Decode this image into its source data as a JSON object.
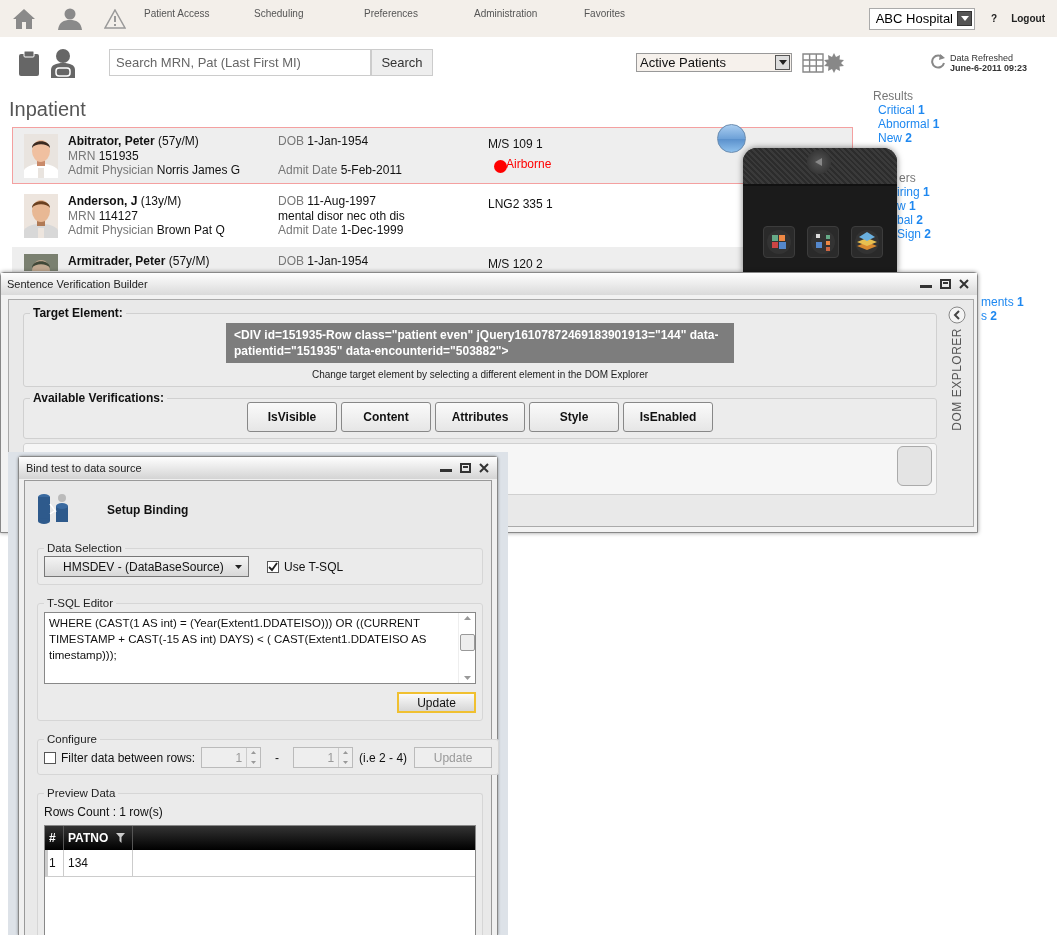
{
  "top_nav": {
    "nav_items": [
      "Patient Access",
      "Scheduling",
      "Preferences",
      "Administration",
      "Favorites"
    ],
    "hospital": "ABC Hospital",
    "help": "?",
    "logout": "Logout"
  },
  "toolbar": {
    "search_placeholder": "Search MRN, Pat (Last First MI)",
    "search_button": "Search",
    "filter": "Active Patients",
    "refresh_label": "Data Refreshed",
    "refresh_time": "June-6-2011 09:23"
  },
  "inpatient": {
    "title": "Inpatient",
    "patients": [
      {
        "name": "Abitrator, Peter",
        "age": "(57y/M)",
        "mrn_label": "MRN",
        "mrn": "151935",
        "physician_label": "Admit Physician",
        "physician": "Norris James G",
        "dob_label": "DOB",
        "dob": "1-Jan-1954",
        "admit_label": "Admit Date",
        "admit_date": "5-Feb-2011",
        "location": "M/S 109 1",
        "alert": {
          "text": "Airborne",
          "color": "#ff0000"
        },
        "selected": true
      },
      {
        "name": "Anderson, J",
        "age": "(13y/M)",
        "mrn_label": "MRN",
        "mrn": "114127",
        "physician_label": "Admit Physician",
        "physician": "Brown Pat Q",
        "dob_label": "DOB",
        "dob": "11-Aug-1997",
        "diagnosis": "mental disor nec oth dis",
        "admit_label": "Admit Date",
        "admit_date": "1-Dec-1999",
        "location": "LNG2 335 1",
        "selected": false
      },
      {
        "name": "Armitrader, Peter",
        "age": "(57y/M)",
        "dob_label": "DOB",
        "dob": "1-Jan-1954",
        "location": "M/S 120 2",
        "selected": false
      }
    ]
  },
  "summary": [
    {
      "title": "Results",
      "items": [
        {
          "label": "Critical",
          "count": "1"
        },
        {
          "label": "Abnormal",
          "count": "1"
        },
        {
          "label": "New",
          "count": "2"
        }
      ]
    },
    {
      "title": "ers",
      "items": [
        {
          "label": "iring",
          "count": "1"
        },
        {
          "label": "w",
          "count": "1"
        },
        {
          "label": "bal",
          "count": "2"
        },
        {
          "label": "Sign",
          "count": "2"
        }
      ]
    },
    {
      "items": [
        {
          "label": "ments",
          "count": "1"
        },
        {
          "label": "s",
          "count": "2"
        }
      ]
    }
  ],
  "verification_builder": {
    "title": "Sentence Verification Builder",
    "target_label": "Target Element:",
    "target_element": "<DIV id=151935-Row class=\"patient even\" jQuery16107872469183901913=\"144\" data-patientid=\"151935\" data-encounterid=\"503882\">",
    "target_hint": "Change target element by selecting a different element in the DOM Explorer",
    "verifications_label": "Available Verifications:",
    "verifications": [
      "IsVisible",
      "Content",
      "Attributes",
      "Style",
      "IsEnabled"
    ],
    "side_tab": "DOM EXPLORER"
  },
  "bind_dialog": {
    "title": "Bind test to data source",
    "heading": "Setup Binding",
    "data_selection": {
      "label": "Data Selection",
      "source": "HMSDEV - (DataBaseSource)",
      "use_tsql": {
        "label": "Use T-SQL",
        "checked": true
      }
    },
    "editor": {
      "label": "T-SQL Editor",
      "sql": "WHERE (CAST(1 AS int) = (Year(Extent1.DDATEISO))) OR ((CURRENT TIMESTAMP + CAST(-15 AS int) DAYS) < ( CAST(Extent1.DDATEISO AS timestamp)));",
      "update": "Update"
    },
    "configure": {
      "label": "Configure",
      "filter": {
        "label": "Filter data between rows:",
        "checked": false
      },
      "from": "1",
      "separator": "-",
      "to": "1",
      "hint": "(i.e 2 - 4)",
      "update": "Update",
      "disabled": true
    },
    "preview": {
      "label": "Preview Data",
      "rows_count": "Rows Count : 1 row(s)",
      "columns": [
        "#",
        "PATNO"
      ],
      "rows": [
        [
          "1",
          "134"
        ]
      ]
    }
  }
}
